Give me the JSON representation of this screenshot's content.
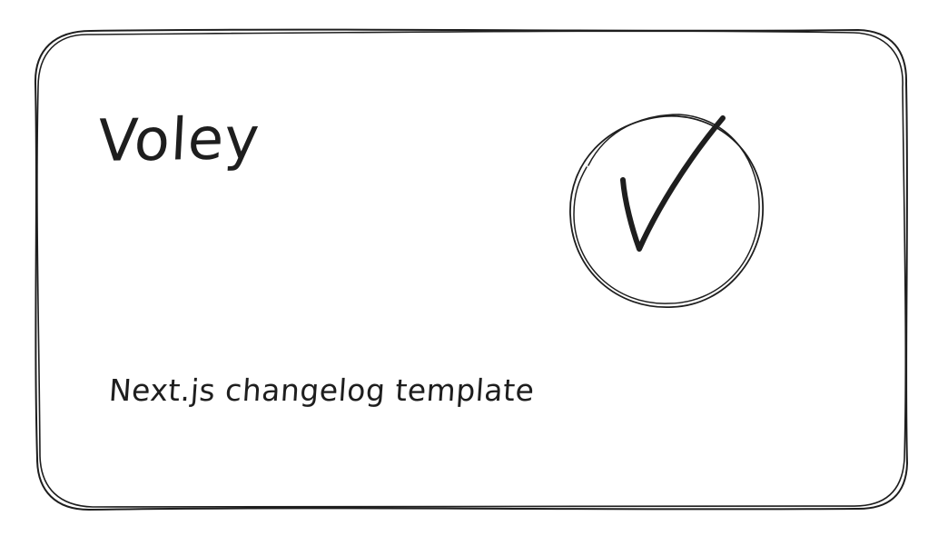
{
  "card": {
    "title": "Voley",
    "subtitle": "Next.js changelog template",
    "icon": "check-circle-icon"
  },
  "colors": {
    "stroke": "#1e1e1e",
    "background": "#ffffff"
  }
}
